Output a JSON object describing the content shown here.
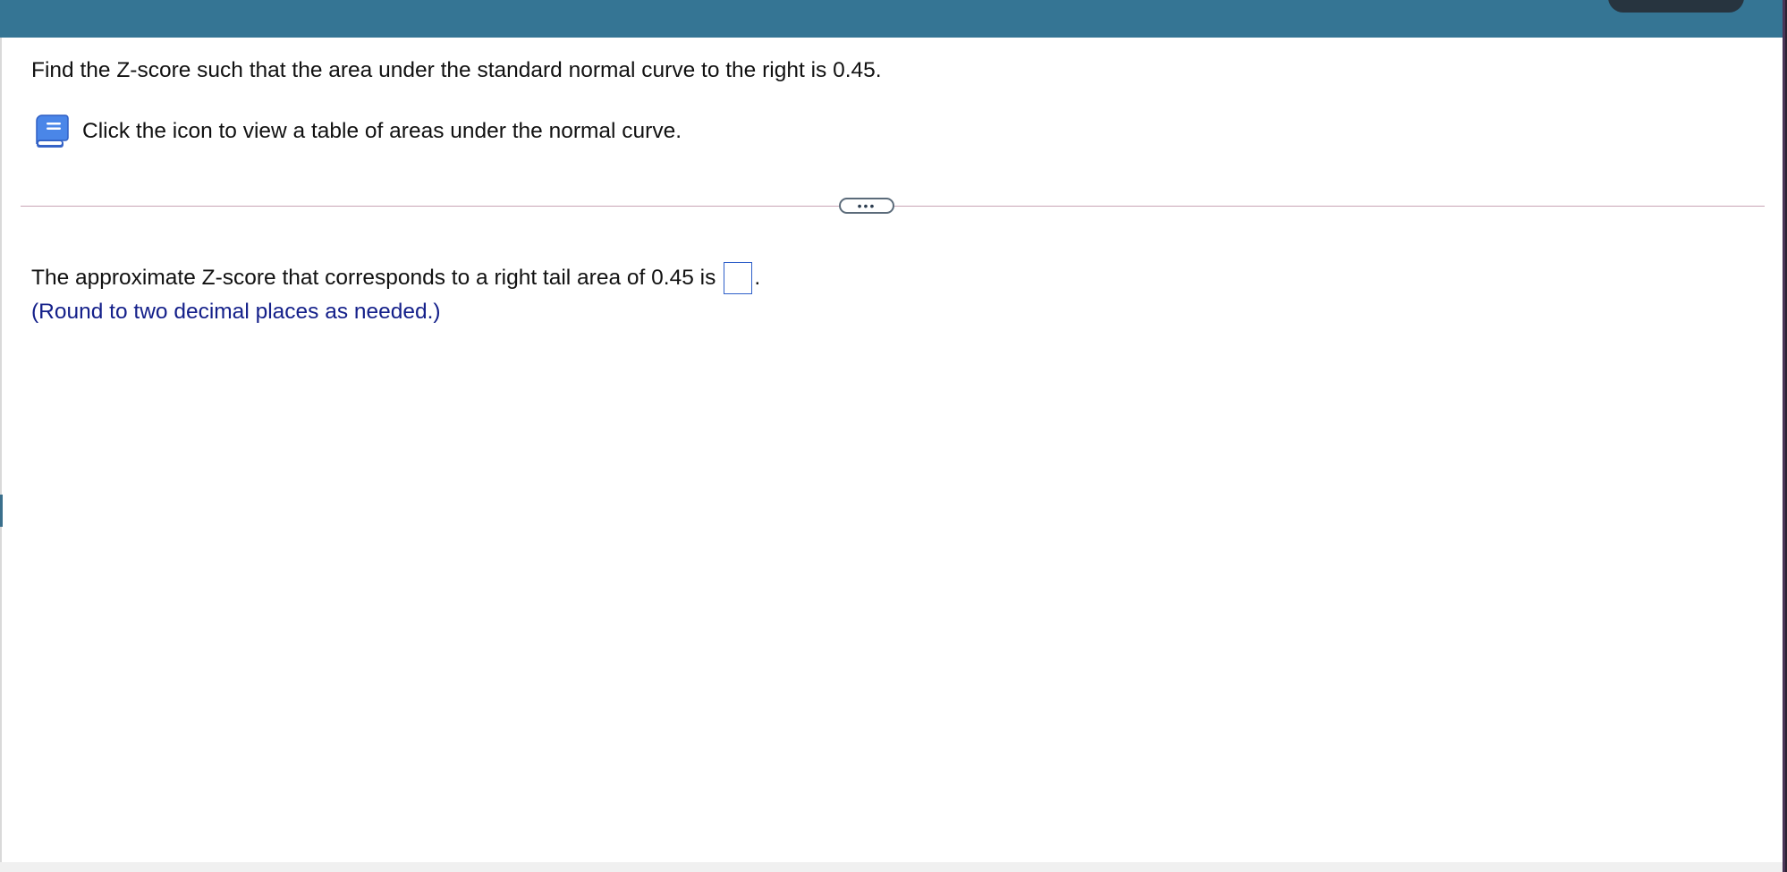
{
  "question": {
    "text": "Find the Z-score such that the area under the standard normal curve to the right is 0.45."
  },
  "help": {
    "icon": "book-icon",
    "text": "Click the icon to view a table of areas under the normal curve."
  },
  "divider": {
    "more_label": "•••"
  },
  "answer": {
    "prefix": "The approximate Z-score that corresponds to a right tail area of 0.45 is",
    "value": "",
    "suffix": ".",
    "hint": "(Round to two decimal places as needed.)"
  },
  "colors": {
    "header": "#357594",
    "hint": "#14208a",
    "input_border": "#2e5fc9"
  }
}
